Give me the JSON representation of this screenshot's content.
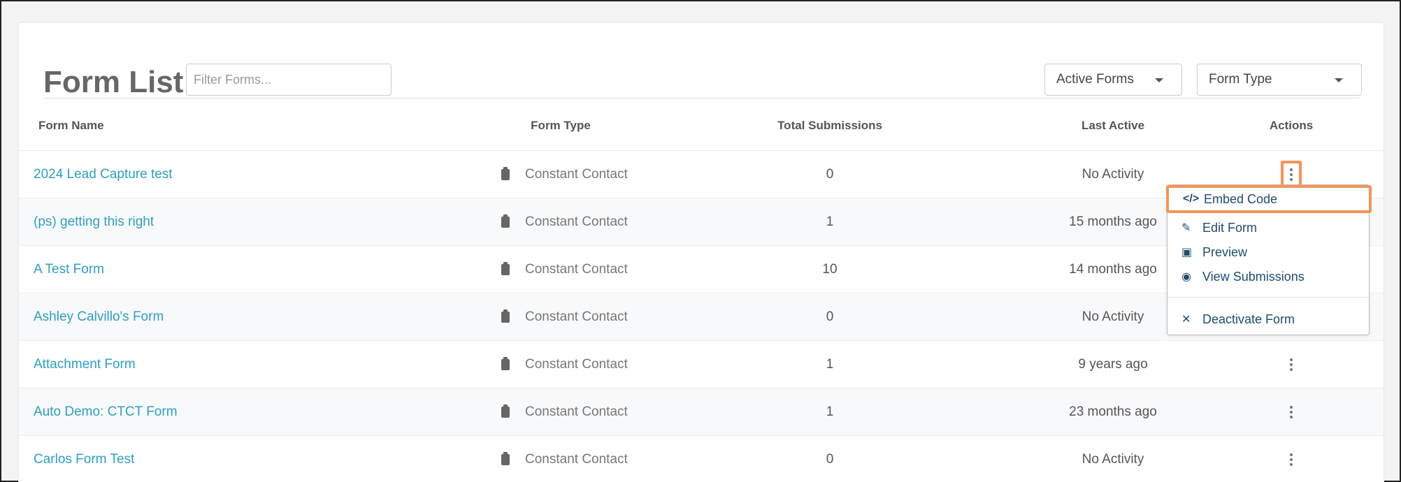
{
  "header": {
    "title": "Form List",
    "filter_placeholder": "Filter Forms...",
    "status_dropdown": "Active Forms",
    "type_dropdown": "Form Type"
  },
  "table": {
    "columns": [
      "Form Name",
      "Form Type",
      "Total Submissions",
      "Last Active",
      "Actions"
    ],
    "rows": [
      {
        "name": "2024 Lead Capture test",
        "type": "Constant Contact",
        "total": "0",
        "last": "No Activity"
      },
      {
        "name": "(ps) getting this right",
        "type": "Constant Contact",
        "total": "1",
        "last": "15 months ago"
      },
      {
        "name": "A Test Form",
        "type": "Constant Contact",
        "total": "10",
        "last": "14 months ago"
      },
      {
        "name": "Ashley Calvillo's Form",
        "type": "Constant Contact",
        "total": "0",
        "last": "No Activity"
      },
      {
        "name": "Attachment Form",
        "type": "Constant Contact",
        "total": "1",
        "last": "9 years ago"
      },
      {
        "name": "Auto Demo: CTCT Form",
        "type": "Constant Contact",
        "total": "1",
        "last": "23 months ago"
      },
      {
        "name": "Carlos Form Test",
        "type": "Constant Contact",
        "total": "0",
        "last": "No Activity"
      }
    ]
  },
  "actions_menu": {
    "items": [
      {
        "label": "Embed Code",
        "icon": "code-icon",
        "glyph": "</>"
      },
      {
        "label": "Edit Form",
        "icon": "edit-icon",
        "glyph": "✎"
      },
      {
        "label": "Preview",
        "icon": "preview-icon",
        "glyph": "▣"
      },
      {
        "label": "View Submissions",
        "icon": "eye-icon",
        "glyph": "◉"
      },
      {
        "label": "Deactivate Form",
        "icon": "close-icon",
        "glyph": "✕"
      }
    ]
  },
  "colors": {
    "link": "#2e9fbf",
    "highlight": "#f3955a",
    "menu_text": "#1f4b6e"
  }
}
